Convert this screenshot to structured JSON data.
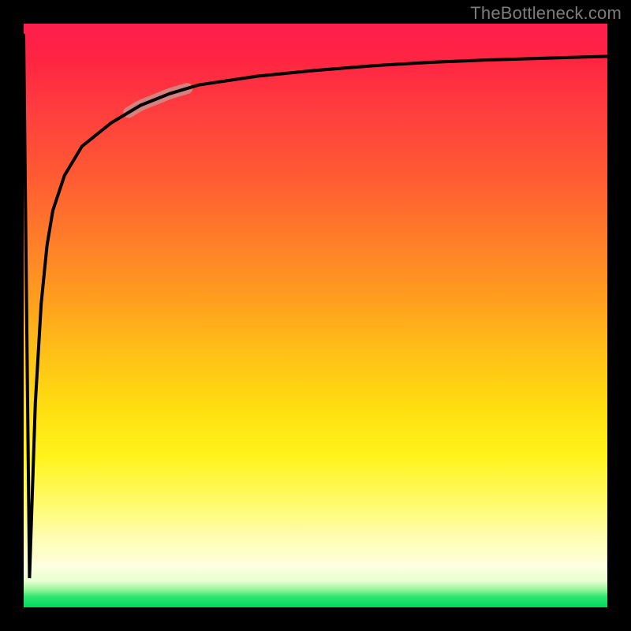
{
  "watermark": "TheBottleneck.com",
  "colors": {
    "background": "#000000",
    "gradient_top": "#ff1e4d",
    "gradient_mid": "#ffde10",
    "gradient_bottom": "#00d95e",
    "curve": "#000000",
    "highlight": "#cf8a86"
  },
  "chart_data": {
    "type": "line",
    "title": "",
    "xlabel": "",
    "ylabel": "",
    "xlim": [
      0,
      100
    ],
    "ylim": [
      0,
      100
    ],
    "grid": false,
    "legend": false,
    "annotations": [
      {
        "kind": "highlighted-segment",
        "x_range": [
          18,
          28
        ],
        "note": "pink rounded highlight on curve"
      }
    ],
    "series": [
      {
        "name": "curve",
        "x": [
          0,
          1,
          2,
          3,
          4,
          5,
          7,
          10,
          15,
          20,
          25,
          30,
          40,
          50,
          60,
          70,
          80,
          90,
          100
        ],
        "y": [
          98,
          5,
          35,
          52,
          62,
          68,
          74,
          79,
          83,
          86,
          88,
          89.5,
          91,
          92,
          92.8,
          93.4,
          93.8,
          94.1,
          94.4
        ]
      }
    ]
  }
}
